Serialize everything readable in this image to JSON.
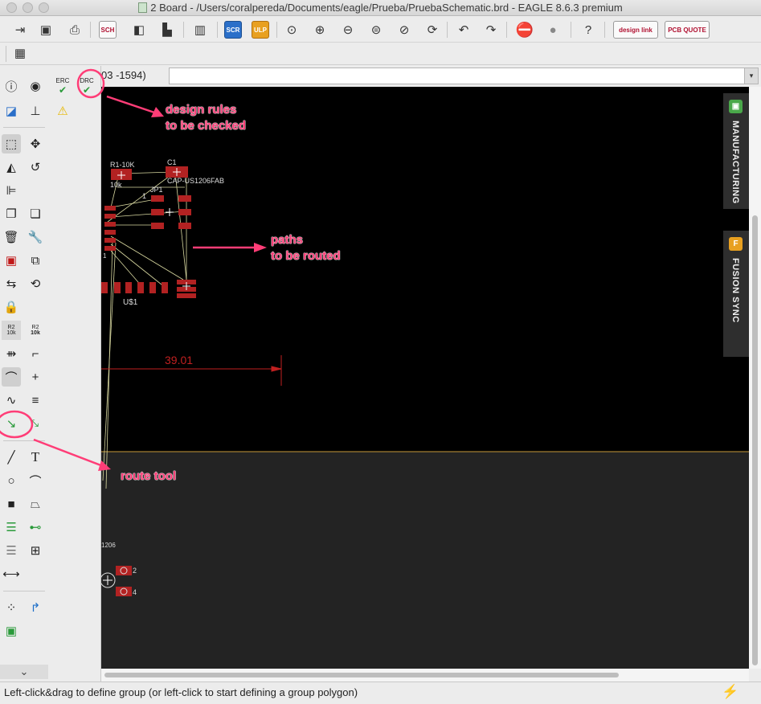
{
  "window": {
    "title": "2 Board - /Users/coralpereda/Documents/eagle/Prueba/PruebaSchematic.brd - EAGLE 8.6.3 premium",
    "doc_badge": "BRD"
  },
  "toolbar": {
    "sch_label": "SCH",
    "scr_label": "SCR",
    "ulp_label": "ULP",
    "designlink_label": "design link",
    "pcbquote_label": "PCB QUOTE"
  },
  "command": {
    "coord_text": "03 -1594)",
    "input_value": ""
  },
  "tools": {
    "erc_label": "ERC",
    "drc_label": "DRC",
    "name_label": "R2",
    "name_sub": "10k",
    "value_label": "R2",
    "value_sub": "10k",
    "text_label": "T"
  },
  "board": {
    "r1_label": "R1-10K",
    "r1_value": "10k",
    "c1_label": "C1",
    "cap_label": "CAP-US1206FAB",
    "jp1_label": "JP1",
    "pin1_label": "1",
    "u1_label": "U$1",
    "one_label": "1",
    "dimension": "39.01",
    "lower_label": "1206",
    "pin2": "2",
    "pin4": "4"
  },
  "side_tabs": {
    "manufacturing": "MANUFACTURING",
    "fusion_sync": "FUSION SYNC"
  },
  "annotations": {
    "design_rules_line1": "design rules",
    "design_rules_line2": "to be checked",
    "paths_line1": "paths",
    "paths_line2": "to be routed",
    "route_tool": "route tool"
  },
  "status": {
    "message": "Left-click&drag to define group (or left-click to start defining a group polygon)"
  },
  "colors": {
    "annotation": "#ff3d77",
    "pad": "#b22222",
    "airwire": "#d8d8a0",
    "dimension": "#c02020",
    "canvas": "#000000",
    "lower_area": "#232323"
  }
}
